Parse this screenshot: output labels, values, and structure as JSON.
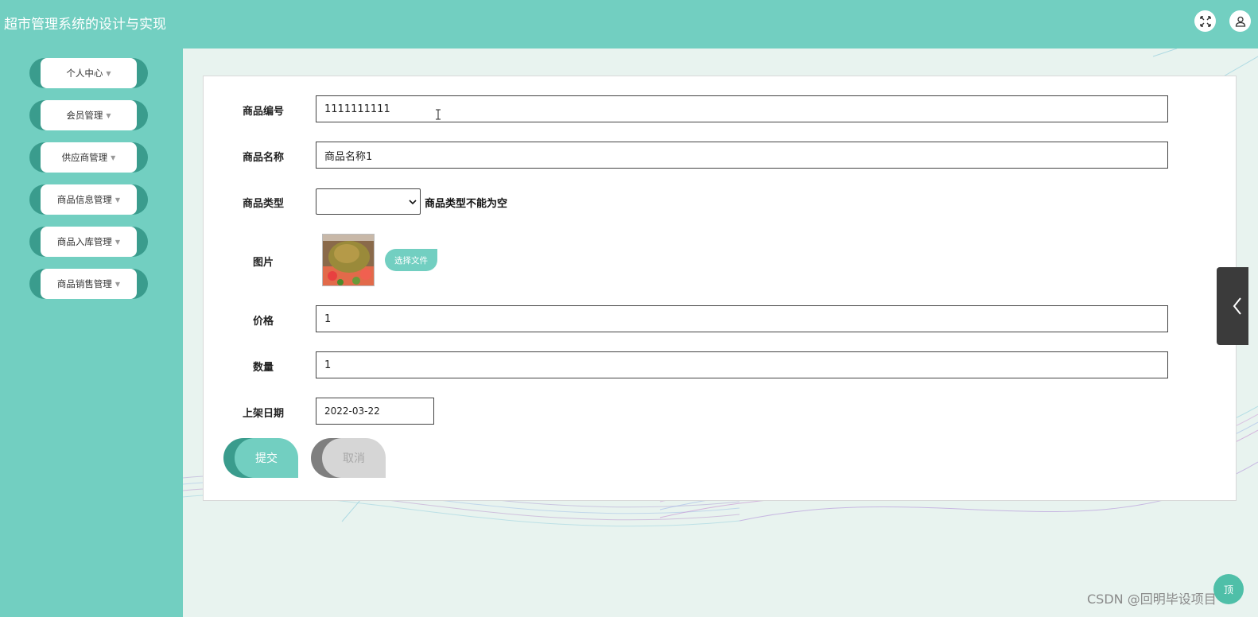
{
  "header": {
    "title": "超市管理系统的设计与实现",
    "fullscreen_icon": "expand-icon",
    "user_icon": "user-icon"
  },
  "sidebar": {
    "items": [
      {
        "label": "个人中心"
      },
      {
        "label": "会员管理"
      },
      {
        "label": "供应商管理"
      },
      {
        "label": "商品信息管理"
      },
      {
        "label": "商品入库管理"
      },
      {
        "label": "商品销售管理"
      }
    ],
    "caret": "▼"
  },
  "form": {
    "product_no": {
      "label": "商品编号",
      "value": "1111111111"
    },
    "product_name": {
      "label": "商品名称",
      "value": "商品名称1"
    },
    "product_type": {
      "label": "商品类型",
      "value": "",
      "error": "商品类型不能为空"
    },
    "image": {
      "label": "图片",
      "button": "选择文件"
    },
    "price": {
      "label": "价格",
      "value": "1"
    },
    "quantity": {
      "label": "数量",
      "value": "1"
    },
    "listing_date": {
      "label": "上架日期",
      "value": "2022-03-22"
    },
    "submit": "提交",
    "cancel": "取消"
  },
  "side_tab_icon": "chevron-left-icon",
  "back_to_top": "顶",
  "watermark": "CSDN @回明毕设项目",
  "colors": {
    "primary": "#72cfc1",
    "primary_dark": "#3a9c8d",
    "background": "#e8f3ef"
  }
}
